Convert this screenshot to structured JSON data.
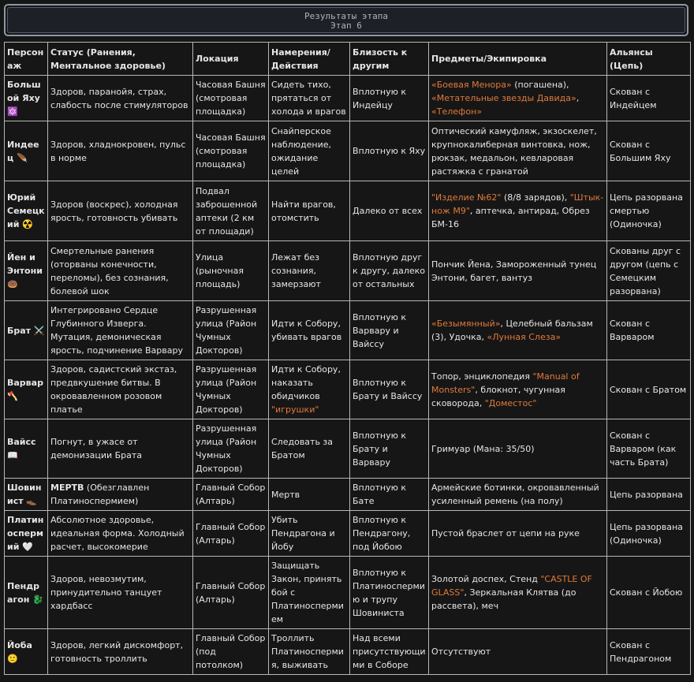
{
  "header": {
    "title": "Результаты этапа",
    "subtitle": "Этап 6"
  },
  "columns": [
    "Персонаж",
    "Статус (Ранения, Ментальное здоровье)",
    "Локация",
    "Намерения/Действия",
    "Близость к другим",
    "Предметы/Экипировка",
    "Альянсы (Цепь)"
  ],
  "rows": [
    {
      "name": "Большой Яху 🔯",
      "status": [
        {
          "t": "Здоров, паранойя, страх, слабость после стимуляторов"
        }
      ],
      "location": "Часовая Башня (смотровая площадка)",
      "intent": [
        {
          "t": "Сидеть тихо, прятаться от холода и врагов"
        }
      ],
      "proximity": "Вплотную к Индейцу",
      "items": [
        {
          "t": "«Боевая Менора»",
          "h": true
        },
        {
          "t": " (погашена), "
        },
        {
          "t": "«Метательные звезды Давида»",
          "h": true
        },
        {
          "t": ", "
        },
        {
          "t": "«Телефон»",
          "h": true
        }
      ],
      "alliance": "Скован с Индейцем"
    },
    {
      "name": "Индеец 🪶",
      "status": [
        {
          "t": "Здоров, хладнокровен, пульс в норме"
        }
      ],
      "location": "Часовая Башня (смотровая площадка)",
      "intent": [
        {
          "t": "Снайперское наблюдение, ожидание целей"
        }
      ],
      "proximity": "Вплотную к Яху",
      "items": [
        {
          "t": "Оптический камуфляж, экзоскелет, крупнокалиберная винтовка, нож, рюкзак, медальон, кевларовая растяжка с гранатой"
        }
      ],
      "alliance": "Скован с Большим Яху"
    },
    {
      "name": "Юрий Семецкий ☢️",
      "status": [
        {
          "t": "Здоров (воскрес), холодная ярость, готовность убивать"
        }
      ],
      "location": "Подвал заброшенной аптеки (2 км от площади)",
      "intent": [
        {
          "t": "Найти врагов, отомстить"
        }
      ],
      "proximity": "Далеко от всех",
      "items": [
        {
          "t": "\"Изделие №62\"",
          "h": true
        },
        {
          "t": " (8/8 зарядов), "
        },
        {
          "t": "\"Штык-нож М9\"",
          "h": true
        },
        {
          "t": ", аптечка, антирад, Обрез БМ-16"
        }
      ],
      "alliance": "Цепь разорвана смертью (Одиночка)"
    },
    {
      "name": "Йен и Энтони 🍩",
      "status": [
        {
          "t": "Смертельные ранения (оторваны конечности, переломы), без сознания, болевой шок"
        }
      ],
      "location": "Улица (рыночная площадь)",
      "intent": [
        {
          "t": "Лежат без сознания, замерзают"
        }
      ],
      "proximity": "Вплотную друг к другу, далеко от остальных",
      "items": [
        {
          "t": "Пончик Йена, Замороженный тунец Энтони, багет, вантуз"
        }
      ],
      "alliance": "Скованы друг с другом (цепь с Семецким разорвана)"
    },
    {
      "name": "Брат ⚔️",
      "status": [
        {
          "t": "Интегрировано Сердце Глубинного Изверга. Мутация, демоническая ярость, подчинение Варвару"
        }
      ],
      "location": "Разрушенная улица (Район Чумных Докторов)",
      "intent": [
        {
          "t": "Идти к Собору, убивать врагов"
        }
      ],
      "proximity": "Вплотную к Варвару и Вайссу",
      "items": [
        {
          "t": "«Безымянный»",
          "h": true
        },
        {
          "t": ", Целебный бальзам (3), Удочка, "
        },
        {
          "t": "«Лунная Слеза»",
          "h": true
        }
      ],
      "alliance": "Скован с Варваром"
    },
    {
      "name": "Варвар 🪓",
      "status": [
        {
          "t": "Здоров, садистский экстаз, предвкушение битвы. В окровавленном розовом платье"
        }
      ],
      "location": "Разрушенная улица (Район Чумных Докторов)",
      "intent": [
        {
          "t": "Идти к Собору, наказать обидчиков "
        },
        {
          "t": "\"игрушки\"",
          "h": true
        }
      ],
      "proximity": "Вплотную к Брату и Вайссу",
      "items": [
        {
          "t": "Топор, энциклопедия "
        },
        {
          "t": "\"Manual of Monsters\"",
          "h": true
        },
        {
          "t": ", блокнот, чугунная сковорода, "
        },
        {
          "t": "\"Доместос\"",
          "h": true
        }
      ],
      "alliance": "Скован с Братом"
    },
    {
      "name": "Вайсс 📖",
      "status": [
        {
          "t": "Погнут, в ужасе от демонизации Брата"
        }
      ],
      "location": "Разрушенная улица (Район Чумных Докторов)",
      "intent": [
        {
          "t": "Следовать за Братом"
        }
      ],
      "proximity": "Вплотную к Брату и Варвару",
      "items": [
        {
          "t": "Гримуар (Мана: 35/50)"
        }
      ],
      "alliance": "Скован с Варваром (как часть Брата)"
    },
    {
      "name": "Шовинист 👞",
      "status": [
        {
          "t": "МЕРТВ",
          "b": true
        },
        {
          "t": " (Обезглавлен Платиноспермием)"
        }
      ],
      "location": "Главный Собор (Алтарь)",
      "intent": [
        {
          "t": "Мертв"
        }
      ],
      "proximity": "Вплотную к Бате",
      "items": [
        {
          "t": "Армейские ботинки, окровавленный усиленный ремень (на полу)"
        }
      ],
      "alliance": "Цепь разорвана"
    },
    {
      "name": "Платиноспермий 🤍",
      "status": [
        {
          "t": "Абсолютное здоровье, идеальная форма. Холодный расчет, высокомерие"
        }
      ],
      "location": "Главный Собор (Алтарь)",
      "intent": [
        {
          "t": "Убить Пендрагона и Йобу"
        }
      ],
      "proximity": "Вплотную к Пендрагону, под Йобою",
      "items": [
        {
          "t": "Пустой браслет от цепи на руке"
        }
      ],
      "alliance": "Цепь разорвана (Одиночка)"
    },
    {
      "name": "Пендрагон 🐉",
      "status": [
        {
          "t": "Здоров, невозмутим, принудительно танцует хардбасс"
        }
      ],
      "location": "Главный Собор (Алтарь)",
      "intent": [
        {
          "t": "Защищать Закон, принять бой с Платиноспермием"
        }
      ],
      "proximity": "Вплотную к Платиноспермию и трупу Шовиниста",
      "items": [
        {
          "t": "Золотой доспех, Стенд "
        },
        {
          "t": "\"CASTLE OF GLASS\"",
          "h": true
        },
        {
          "t": ", Зеркальная Клятва (до рассвета), меч"
        }
      ],
      "alliance": "Скован с Йобою"
    },
    {
      "name": "Йоба 🙂",
      "status": [
        {
          "t": "Здоров, легкий дискомфорт, готовность троллить"
        }
      ],
      "location": "Главный Собор (под потолком)",
      "intent": [
        {
          "t": "Троллить Платиноспермия, выживать"
        }
      ],
      "proximity": "Над всеми присутствующими в Соборе",
      "items": [
        {
          "t": "Отсутствуют"
        }
      ],
      "alliance": "Скован с Пендрагоном"
    }
  ]
}
